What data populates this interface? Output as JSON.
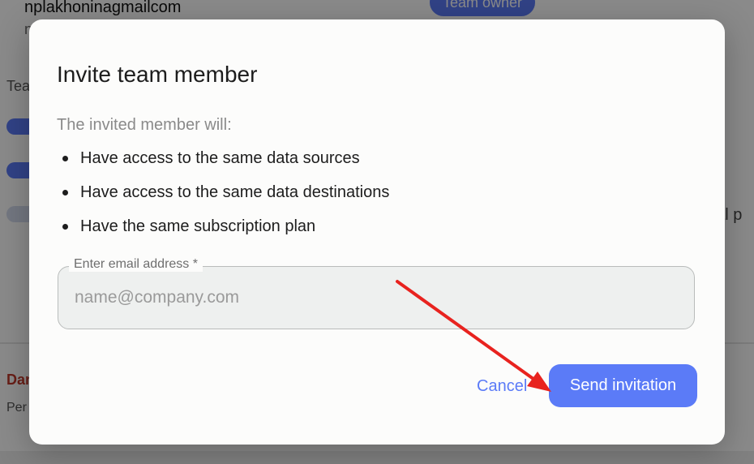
{
  "background": {
    "user_email": "nplakhoninagmailcom",
    "user_sub": "n",
    "badge_label": "Team owner",
    "team_section_label": "Tea",
    "right_fragment": "nal p",
    "danger_label": "Dan",
    "per_label": "Per"
  },
  "dialog": {
    "title": "Invite team member",
    "intro": "The invited member will:",
    "bullets": [
      "Have access to the same data sources",
      "Have access to the same data destinations",
      "Have the same subscription plan"
    ],
    "email_label": "Enter email address *",
    "email_placeholder": "name@company.com",
    "email_value": "",
    "cancel_label": "Cancel",
    "send_label": "Send invitation"
  },
  "colors": {
    "accent": "#5b7bf7",
    "annotation_arrow": "#e8231f",
    "danger": "#c0392b"
  }
}
